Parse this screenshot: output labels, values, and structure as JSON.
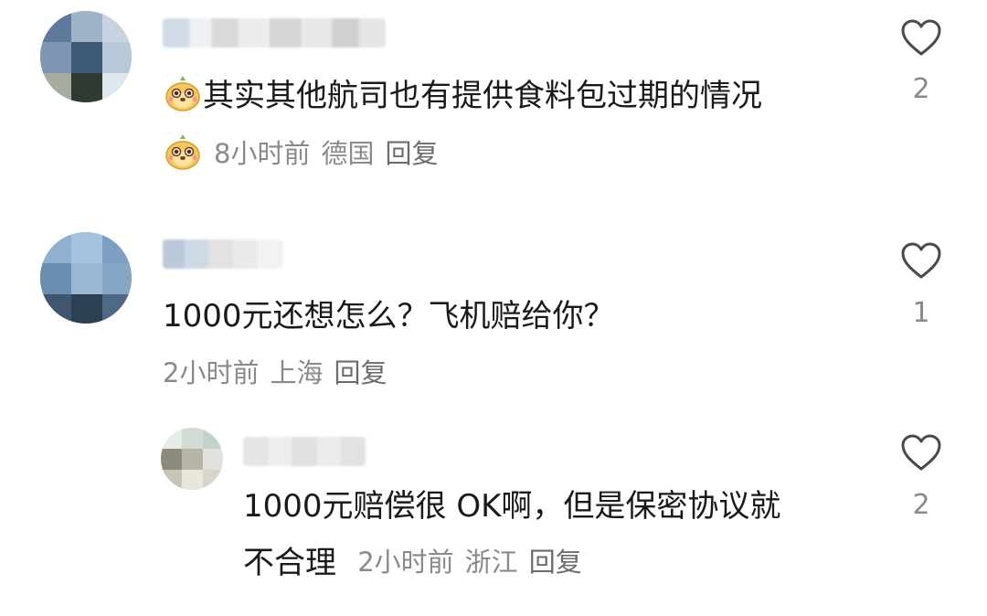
{
  "comments": [
    {
      "text": "其实其他航司也有提供食料包过期的情况",
      "time": "8小时前",
      "location": "德国",
      "reply_label": "回复",
      "likes": "2"
    },
    {
      "text": "1000元还想怎么？飞机赔给你？",
      "time": "2小时前",
      "location": "上海",
      "reply_label": "回复",
      "likes": "1"
    },
    {
      "text_line1": "1000元赔偿很 OK啊，但是保密协议就",
      "text_line2": "不合理",
      "time": "2小时前",
      "location": "浙江",
      "reply_label": "回复",
      "likes": "2"
    }
  ],
  "icons": {
    "like": "heart-outline-icon",
    "emoji": "meerkat-sticker-icon"
  },
  "colors": {
    "text": "#1a1a1a",
    "meta": "#8a8a8a",
    "heart": "#4a4a4a"
  }
}
